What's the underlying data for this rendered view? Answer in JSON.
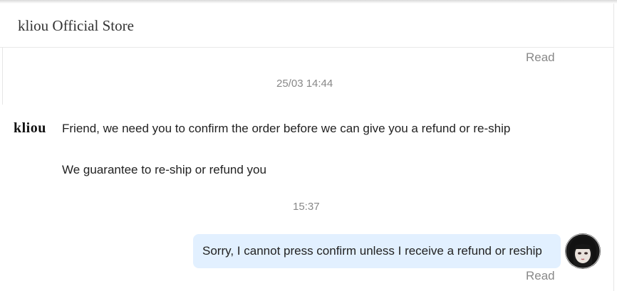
{
  "header": {
    "title": "kliou Official Store"
  },
  "store": {
    "logo_text": "kliou"
  },
  "messages": [
    {
      "type": "status",
      "text": "Read"
    },
    {
      "type": "timestamp",
      "text": "25/03 14:44"
    },
    {
      "type": "incoming",
      "text": "Friend, we need you to confirm the order before we can give you a refund or re-ship"
    },
    {
      "type": "incoming",
      "text": "We guarantee to re-ship or refund you"
    },
    {
      "type": "timestamp",
      "text": "15:37"
    },
    {
      "type": "outgoing",
      "text": "Sorry, I cannot press confirm unless I receive a refund or reship"
    },
    {
      "type": "status",
      "text": "Read"
    }
  ],
  "colors": {
    "outgoing_bubble": "#e2f0ff",
    "meta_text": "#888888"
  }
}
